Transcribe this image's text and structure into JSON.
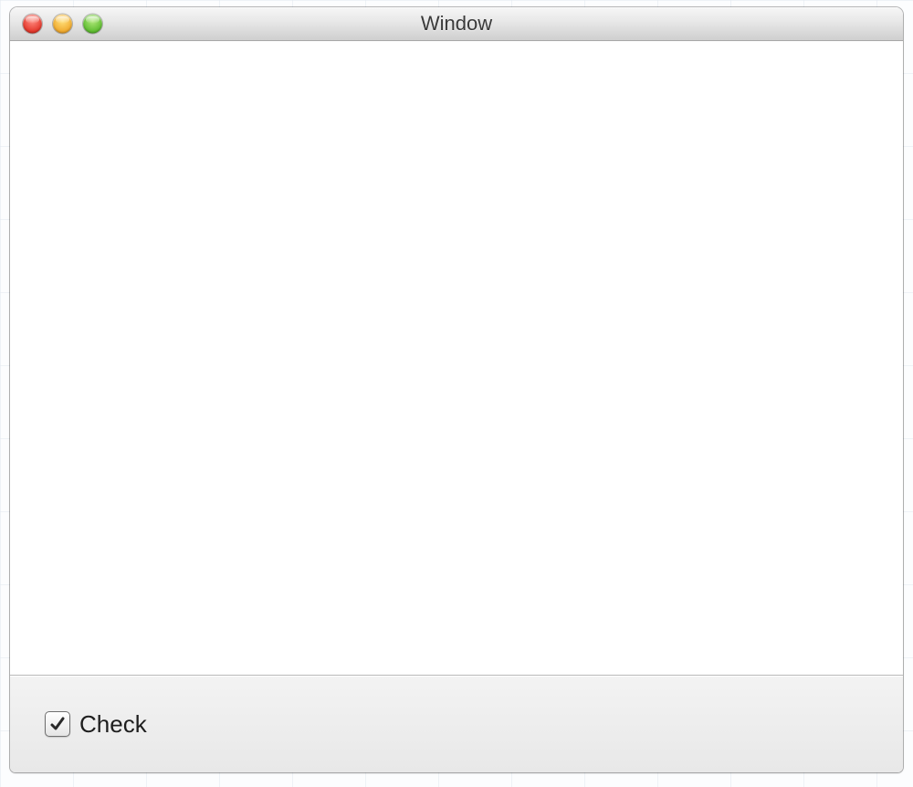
{
  "window": {
    "title": "Window"
  },
  "footer": {
    "checkbox": {
      "label": "Check",
      "checked": true
    }
  }
}
